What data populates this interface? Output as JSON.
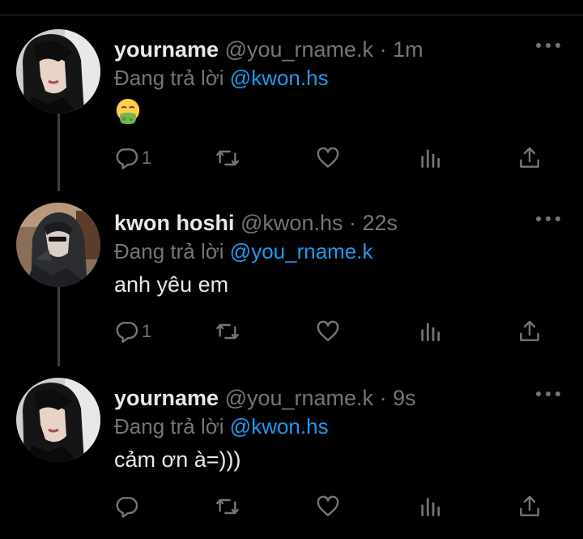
{
  "thread": {
    "tweets": [
      {
        "name": "yourname",
        "handle": "@you_rname.k",
        "dot": "·",
        "time": "1m",
        "reply_prefix": "Đang trả lời",
        "reply_mention": "@kwon.hs",
        "text": "",
        "emoji": "nauseated-face",
        "avatar": "dark-haired-woman-avatar",
        "reply_count": "1"
      },
      {
        "name": "kwon hoshi",
        "handle": "@kwon.hs",
        "dot": "·",
        "time": "22s",
        "reply_prefix": "Đang trả lời",
        "reply_mention": "@you_rname.k",
        "text": "anh yêu em",
        "avatar": "man-in-hood-avatar",
        "reply_count": "1"
      },
      {
        "name": "yourname",
        "handle": "@you_rname.k",
        "dot": "·",
        "time": "9s",
        "reply_prefix": "Đang trả lời",
        "reply_mention": "@kwon.hs",
        "text": "cảm ơn à=)))",
        "avatar": "dark-haired-woman-avatar",
        "reply_count": ""
      }
    ]
  },
  "colors": {
    "background": "#000000",
    "primary_text": "#e7e9ea",
    "secondary_text": "#71767b",
    "mention": "#1d9bf0",
    "thread_line": "#3a3f44"
  }
}
